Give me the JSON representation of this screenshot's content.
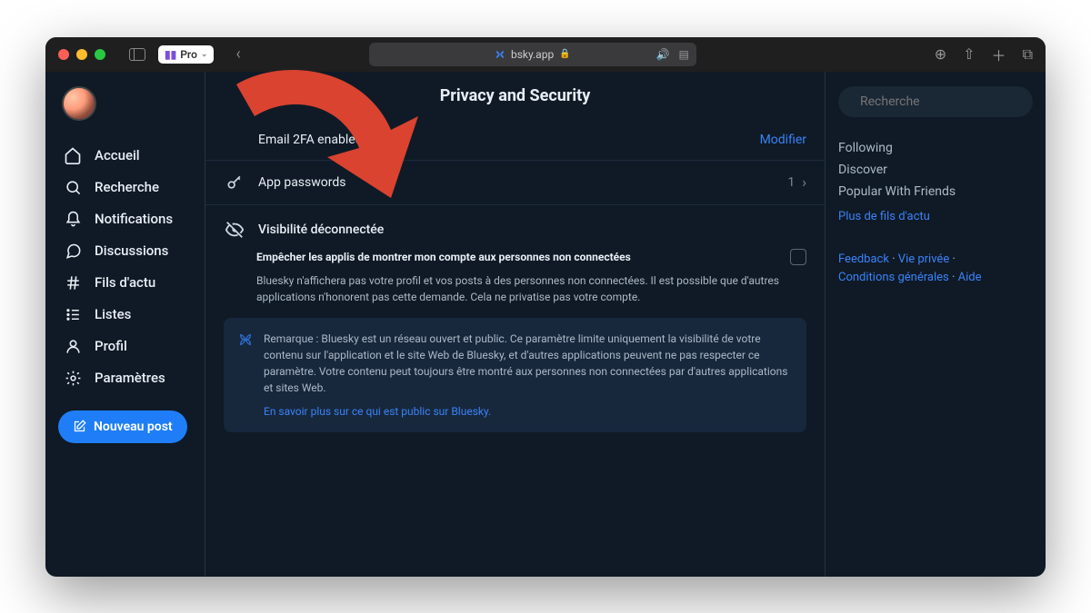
{
  "titlebar": {
    "pro_label": "Pro",
    "url": "bsky.app"
  },
  "nav": {
    "items": [
      {
        "label": "Accueil",
        "icon": "home"
      },
      {
        "label": "Recherche",
        "icon": "search"
      },
      {
        "label": "Notifications",
        "icon": "bell"
      },
      {
        "label": "Discussions",
        "icon": "chat"
      },
      {
        "label": "Fils d'actu",
        "icon": "hash"
      },
      {
        "label": "Listes",
        "icon": "list"
      },
      {
        "label": "Profil",
        "icon": "profile"
      },
      {
        "label": "Paramètres",
        "icon": "gear"
      }
    ],
    "new_post": "Nouveau post"
  },
  "main": {
    "title": "Privacy and Security",
    "email_2fa": {
      "label": "Email 2FA enabled",
      "action": "Modifier"
    },
    "app_pw": {
      "label": "App passwords",
      "count": "1"
    },
    "visibility": {
      "title": "Visibilité déconnectée",
      "toggle_label": "Empêcher les applis de montrer mon compte aux personnes non connectées",
      "desc": "Bluesky n'affichera pas votre profil et vos posts à des personnes non connectées. Il est possible que d'autres applications n'honorent pas cette demande. Cela ne privatise pas votre compte.",
      "note": "Remarque : Bluesky est un réseau ouvert et public. Ce paramètre limite uniquement la visibilité de votre contenu sur l'application et le site Web de Bluesky, et d'autres applications peuvent ne pas respecter ce paramètre. Votre contenu peut toujours être montré aux personnes non connectées par d'autres applications et sites Web.",
      "note_link": "En savoir plus sur ce qui est public sur Bluesky."
    }
  },
  "right": {
    "search_placeholder": "Recherche",
    "feeds": [
      "Following",
      "Discover",
      "Popular With Friends"
    ],
    "more": "Plus de fils d'actu",
    "footer": {
      "feedback": "Feedback",
      "privacy": "Vie privée",
      "terms": "Conditions générales",
      "help": "Aide",
      "sep": " · "
    }
  }
}
